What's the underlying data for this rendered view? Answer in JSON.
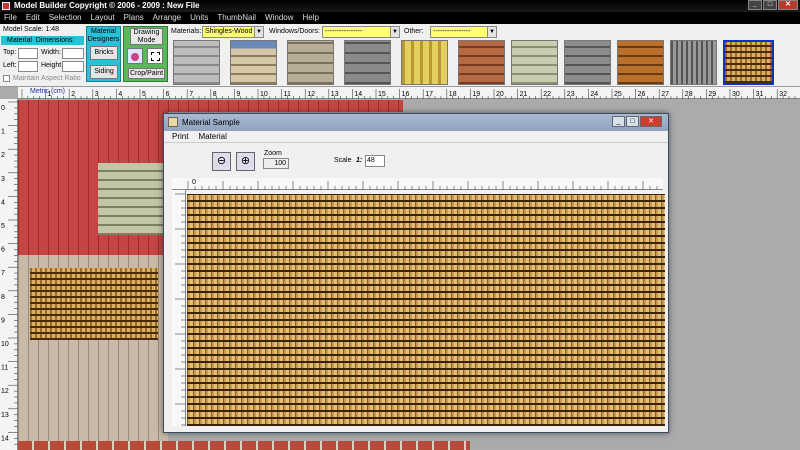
{
  "window": {
    "title": "Model Builder Copyright © 2006 - 2009 : New File"
  },
  "menu": [
    "File",
    "Edit",
    "Selection",
    "Layout",
    "Plans",
    "Arrange",
    "Units",
    "ThumbNail",
    "Window",
    "Help"
  ],
  "toolbar": {
    "model_scale_label": "Model Scale: 1:48",
    "material_label": "Material",
    "dimensions_label": "Dimensions:",
    "top_label": "Top:",
    "width_label": "Width:",
    "left_label": "Left:",
    "height_label": "Height:",
    "maintain_aspect": "Maintain Aspect Ratio",
    "material_designers": "Material Designers",
    "bricks": "Bricks",
    "siding": "Siding",
    "drawing_mode": "Drawing Mode",
    "crop_paint": "Crop/Paint",
    "materials_label": "Materials:",
    "materials_value": "Shingles-Wood",
    "windows_label": "Windows/Doors:",
    "windows_value": "----------------",
    "other_label": "Other:",
    "other_value": "----------------"
  },
  "ruler": {
    "unit_label": "Metric (cm)",
    "top_numbers": [
      "0",
      "1",
      "2",
      "3",
      "4",
      "5",
      "6",
      "7",
      "8",
      "9",
      "10",
      "11",
      "12",
      "13",
      "14",
      "15",
      "16",
      "17",
      "18",
      "19",
      "20",
      "21",
      "22",
      "23",
      "24",
      "25",
      "26",
      "27",
      "28",
      "29",
      "30",
      "31",
      "32"
    ],
    "left_numbers": [
      "0",
      "1",
      "2",
      "3",
      "4",
      "5",
      "6",
      "7",
      "8",
      "9",
      "10",
      "11",
      "12",
      "13",
      "14"
    ]
  },
  "dialog": {
    "title": "Material Sample",
    "menu": [
      "Print",
      "Material"
    ],
    "zoom_label": "Zoom",
    "zoom_value": "100",
    "scale_label": "Scale",
    "scale_prefix": "1:",
    "scale_value": "48",
    "ruler_zero": "0"
  },
  "colors": {
    "accent_cyan": "#2ac0d8",
    "drawing_green": "#5ab85a",
    "selected_border": "#1030c0"
  }
}
